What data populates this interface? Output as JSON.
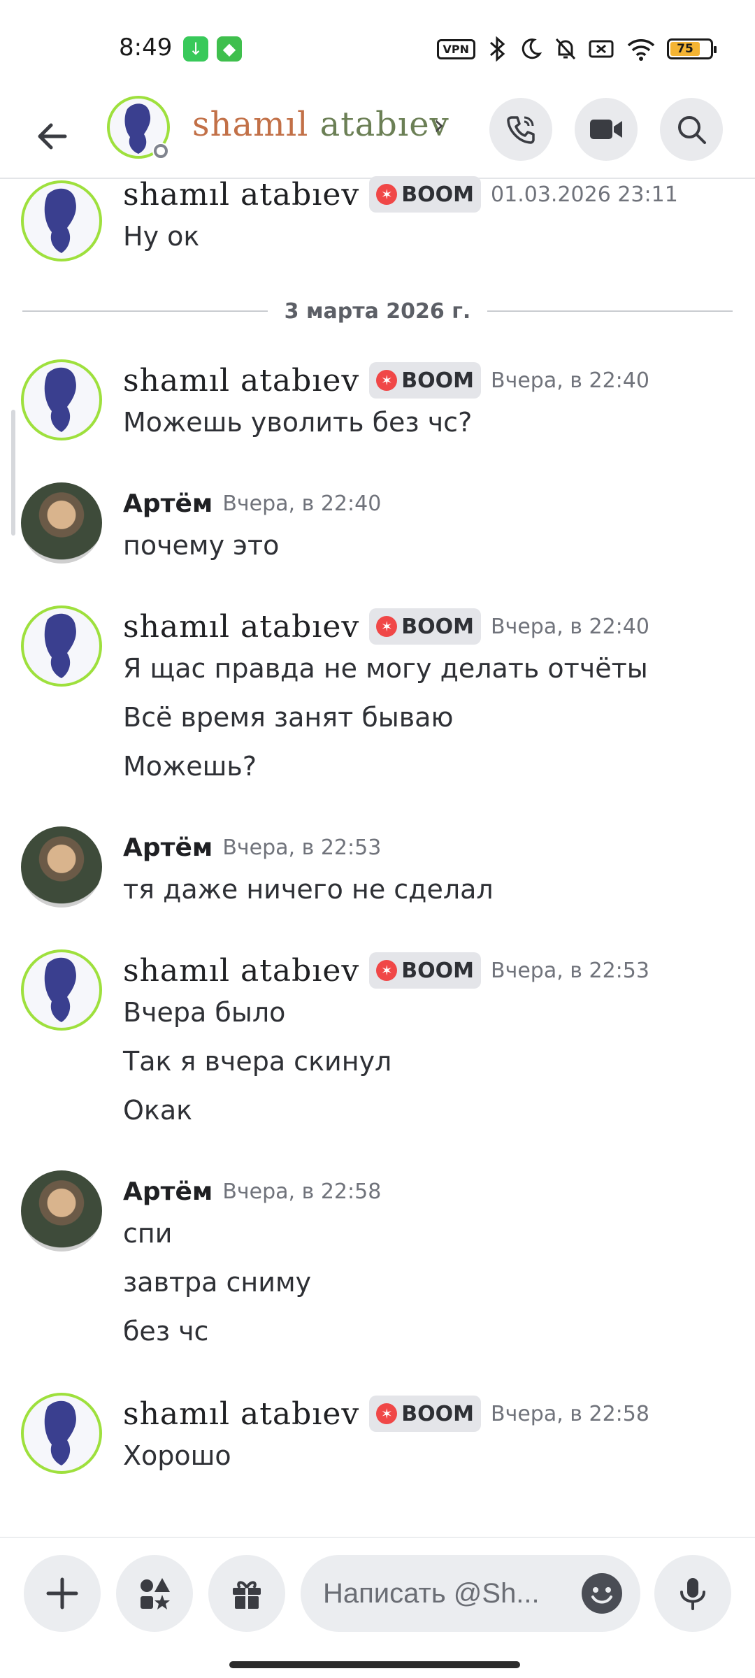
{
  "status_bar": {
    "time": "8:49",
    "vpn_label": "VPN",
    "battery_level": "75"
  },
  "header": {
    "name_part1": "shamıl",
    "name_part2": "atabıev",
    "chevron": "›"
  },
  "badge_label": "BOOM",
  "date_divider": "3 марта 2026 г.",
  "messages": [
    {
      "author": "shamıl atabıev",
      "time": "01.03.2026 23:11",
      "lines": [
        "Ну ок"
      ]
    },
    {
      "author": "shamıl atabıev",
      "time": "Вчера, в 22:40",
      "lines": [
        "Можешь уволить без чс?"
      ]
    },
    {
      "author": "Артём",
      "time": "Вчера, в 22:40",
      "lines": [
        "почему это"
      ]
    },
    {
      "author": "shamıl atabıev",
      "time": "Вчера, в 22:40",
      "lines": [
        "Я щас правда не могу делать отчёты",
        "Всё время занят бываю",
        "Можешь?"
      ]
    },
    {
      "author": "Артём",
      "time": "Вчера, в 22:53",
      "lines": [
        "тя даже ничего не сделал"
      ]
    },
    {
      "author": "shamıl atabıev",
      "time": "Вчера, в 22:53",
      "lines": [
        "Вчера было",
        "Так я вчера скинул",
        "Окак"
      ]
    },
    {
      "author": "Артём",
      "time": "Вчера, в 22:58",
      "lines": [
        "спи",
        "завтра сниму",
        "без чс"
      ]
    },
    {
      "author": "shamıl atabıev",
      "time": "Вчера, в 22:58",
      "lines": [
        "Хорошо"
      ]
    }
  ],
  "composer": {
    "placeholder": "Написать @Sh..."
  },
  "icons": {
    "back": "arrow-left-icon",
    "call": "phone-icon",
    "video": "video-camera-icon",
    "search": "search-icon",
    "plus": "plus-icon",
    "apps": "apps-icon",
    "gift": "gift-icon",
    "emoji": "emoji-icon",
    "mic": "microphone-icon"
  },
  "colors": {
    "name_part1": "#c27047",
    "name_part2": "#6b7f55",
    "avatar_ring": "#9ee03d",
    "badge_bg": "#e4e5e9"
  }
}
